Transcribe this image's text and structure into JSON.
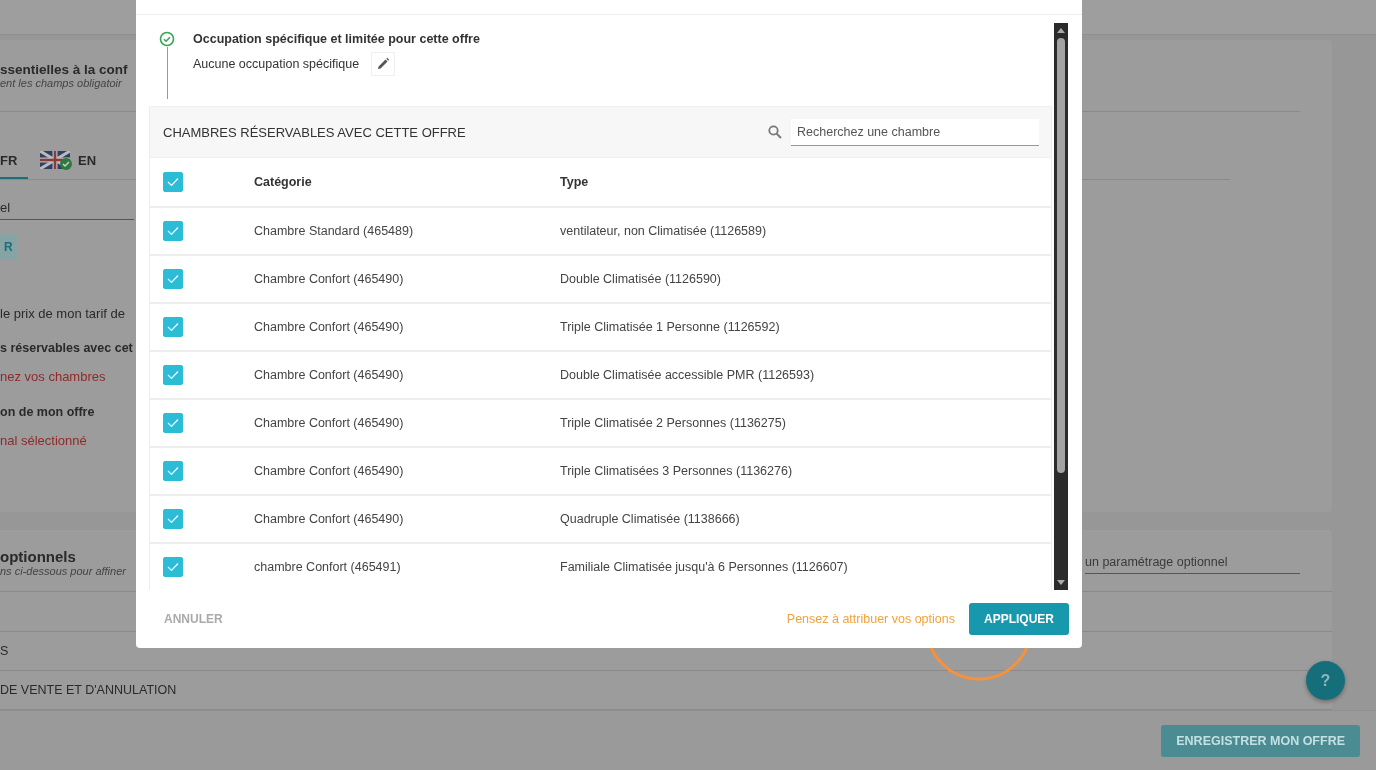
{
  "background": {
    "section_title": "ssentielles à la conf",
    "section_subtitle": "ent les champs obligatoir",
    "language_tabs": [
      {
        "label": "FR",
        "selected": true
      },
      {
        "label": "EN",
        "selected": false,
        "verified": true
      }
    ],
    "field_value": "el",
    "small_button": "R",
    "price_text": "le prix de mon tarif de",
    "rooms_label": "s réservables avec cet",
    "rooms_value": "nez vos chambres",
    "option_label": "on de mon offre",
    "option_value": "nal sélectionné",
    "optional_title": "optionnels",
    "optional_subtitle": "ns ci-dessous pour affiner",
    "optional_search": {
      "placeholder": "un paramétrage optionnel"
    },
    "optional_items": [
      "S",
      "DE VENTE ET D'ANNULATION"
    ]
  },
  "modal": {
    "occupation": {
      "title": "Occupation spécifique et limitée pour cette offre",
      "value": "Aucune occupation spécifique",
      "done": true
    },
    "rooms_panel": {
      "title": "CHAMBRES RÉSERVABLES AVEC CETTE OFFRE",
      "search": {
        "placeholder": "Recherchez une chambre"
      },
      "select_all_checked": true,
      "columns": [
        "Catégorie",
        "Type"
      ],
      "rows": [
        {
          "category": "Chambre Standard (465489)",
          "type": "ventilateur, non Climatisée (1126589)",
          "checked": true
        },
        {
          "category": "Chambre Confort (465490)",
          "type": "Double Climatisée (1126590)",
          "checked": true
        },
        {
          "category": "Chambre Confort (465490)",
          "type": "Triple Climatisée 1 Personne (1126592)",
          "checked": true
        },
        {
          "category": "Chambre Confort (465490)",
          "type": "Double Climatisée accessible PMR (1126593)",
          "checked": true
        },
        {
          "category": "Chambre Confort (465490)",
          "type": "Triple Climatisée 2 Personnes (1136275)",
          "checked": true
        },
        {
          "category": "Chambre Confort (465490)",
          "type": "Triple Climatisées 3 Personnes (1136276)",
          "checked": true
        },
        {
          "category": "Chambre Confort (465490)",
          "type": "Quadruple Climatisée (1138666)",
          "checked": true
        },
        {
          "category": "chambre Confort (465491)",
          "type": "Familiale Climatisée jusqu'à 6 Personnes (1126607)",
          "checked": true
        }
      ]
    },
    "footer": {
      "cancel": "ANNULER",
      "hint": "Pensez à attribuer vos options",
      "apply": "APPLIQUER"
    }
  },
  "help_button": "?",
  "save_button": "ENREGISTRER MON OFFRE"
}
